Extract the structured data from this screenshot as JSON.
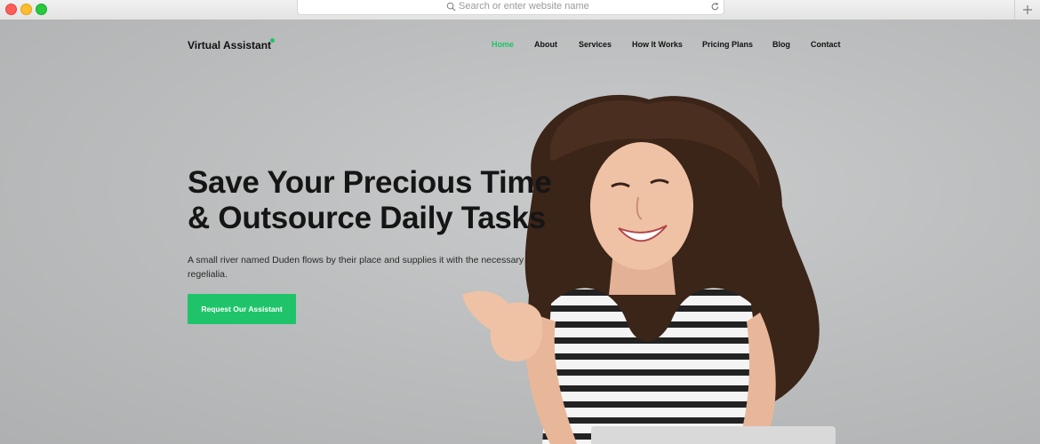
{
  "browser": {
    "address_placeholder": "Search or enter website name"
  },
  "navbar": {
    "brand": "Virtual Assistant",
    "links": [
      "Home",
      "About",
      "Services",
      "How It Works",
      "Pricing Plans",
      "Blog",
      "Contact"
    ],
    "active": "Home"
  },
  "hero": {
    "headline_line1": "Save Your Precious Time",
    "headline_line2": "& Outsource Daily Tasks",
    "subtext": "A small river named Duden flows by their place and supplies it with the necessary regelialia.",
    "cta_label": "Request Our Assistant"
  },
  "colors": {
    "accent": "#1fc46a",
    "background": "#bfc1c2",
    "text": "#151515"
  },
  "icons": [
    "search-icon",
    "reload-icon",
    "new-tab-icon"
  ]
}
